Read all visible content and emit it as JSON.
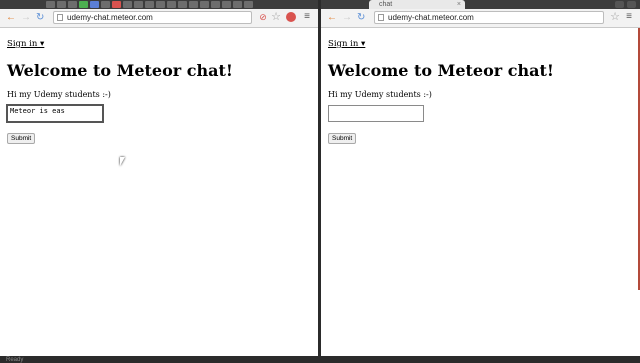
{
  "left": {
    "url": "udemy-chat.meteor.com",
    "signin": "Sign in ▾",
    "heading": "Welcome to Meteor chat!",
    "subtitle": "Hi my Udemy students :-)",
    "textarea_value": "Meteor is eas",
    "submit": "Submit"
  },
  "right": {
    "tab_title": "chat",
    "tab_close": "×",
    "url": "udemy-chat.meteor.com",
    "signin": "Sign in ▾",
    "heading": "Welcome to Meteor chat!",
    "subtitle": "Hi my Udemy students :-)",
    "textarea_value": "",
    "submit": "Submit"
  },
  "icons": {
    "back": "←",
    "forward": "→",
    "reload": "↻",
    "star": "☆",
    "menu": "≡",
    "ext": "⊘"
  },
  "status": {
    "text": "Ready"
  },
  "colors": {
    "back_arrow": "#e07b2a",
    "reload": "#5b8fd6",
    "ext_red": "#d9534f"
  }
}
